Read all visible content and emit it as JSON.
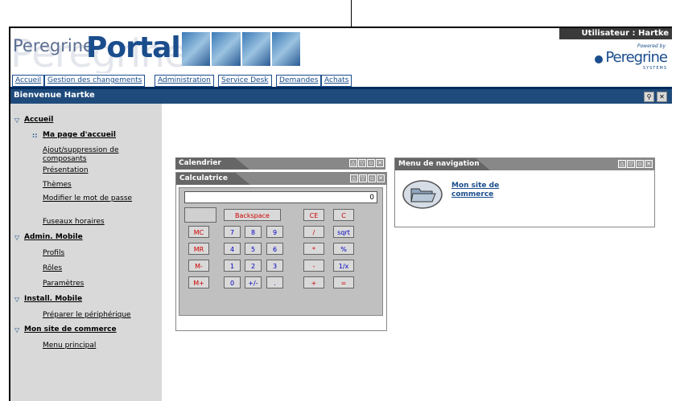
{
  "header": {
    "logo_ghost": "Peregrine",
    "logo_peregrine": "Peregrine",
    "logo_portal": "Portal",
    "user_label": "Utilisateur : Hartke",
    "powered_by": "Powered by",
    "brand": "Peregrine",
    "brand_sub": "SYSTEMS"
  },
  "tabs": [
    "Accueil",
    "Gestion des changements",
    "Administration",
    "Service Desk",
    "Demandes",
    "Achats"
  ],
  "welcome": {
    "text": "Bienvenue Hartke",
    "icons": [
      "search-icon",
      "close-icon"
    ]
  },
  "sidebar": {
    "groups": [
      {
        "label": "Accueil",
        "items": [
          "Ma page d'accueil",
          "Ajout/suppression de composants",
          "Présentation",
          "Thèmes",
          "Modifier le mot de passe",
          "Fuseaux horaires"
        ]
      },
      {
        "label": "Admin. Mobile",
        "items": [
          "Profils",
          "Rôles",
          "Paramètres"
        ]
      },
      {
        "label": "Install. Mobile",
        "items": [
          "Préparer le périphérique"
        ]
      },
      {
        "label": "Mon site de commerce",
        "items": [
          "Menu principal"
        ]
      }
    ]
  },
  "panels": {
    "calendar": {
      "title": "Calendrier"
    },
    "calculator": {
      "title": "Calculatrice",
      "display": "0",
      "buttons": {
        "backspace": "Backspace",
        "ce": "CE",
        "c": "C",
        "mc": "MC",
        "mr": "MR",
        "ms": "M-",
        "mplus": "M+",
        "n7": "7",
        "n8": "8",
        "n9": "9",
        "div": "/",
        "sqrt": "sqrt",
        "n4": "4",
        "n5": "5",
        "n6": "6",
        "mul": "*",
        "pct": "%",
        "n1": "1",
        "n2": "2",
        "n3": "3",
        "sub": "-",
        "inv": "1/x",
        "n0": "0",
        "sign": "+/-",
        "dot": ".",
        "add": "+",
        "eq": "="
      }
    },
    "navigation": {
      "title": "Menu de navigation",
      "link": "Mon site de commerce"
    }
  },
  "colors": {
    "header_blue": "#1f4b7c",
    "sidebar_gray": "#d9d9d9",
    "panel_title": "#666666"
  }
}
